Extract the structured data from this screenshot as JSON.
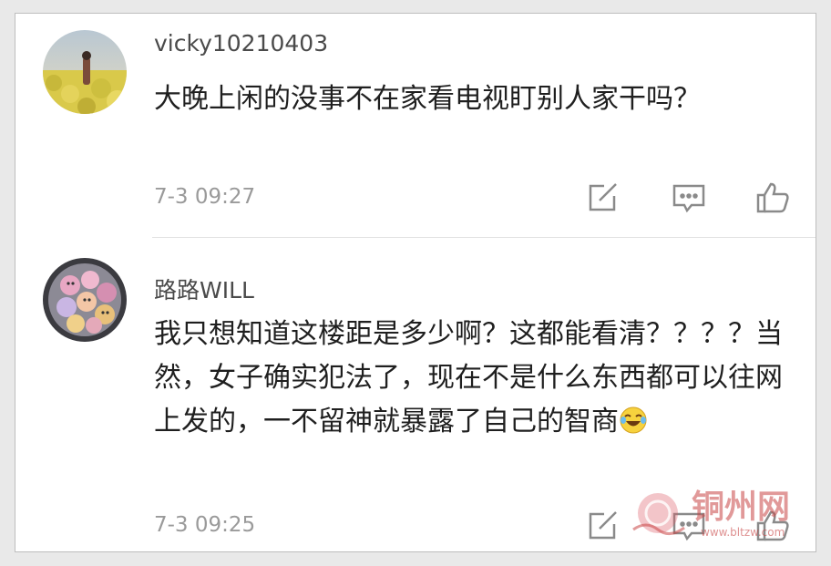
{
  "comments": [
    {
      "username": "vicky10210403",
      "text": "大晚上闲的没事不在家看电视盯别人家干吗？",
      "time": "7-3 09:27"
    },
    {
      "username": "路路WILL",
      "text": "我只想知道这楼距是多少啊？这都能看清？？？？当然，女子确实犯法了，现在不是什么东西都可以往网上发的，一不留神就暴露了自己的智商",
      "time": "7-3 09:25"
    }
  ],
  "icons": {
    "edit": "edit-icon",
    "reply": "comment-icon",
    "like": "thumbs-up-icon",
    "emoji": "laughing-crying-emoji"
  },
  "watermark": {
    "name": "铜州网",
    "url": "www.bltzw.com"
  },
  "colors": {
    "username": "#4a4a4a",
    "text": "#1f1f1f",
    "timestamp": "#9a9a9a",
    "icons": "#8a8a8a",
    "watermark": "#c84646"
  }
}
